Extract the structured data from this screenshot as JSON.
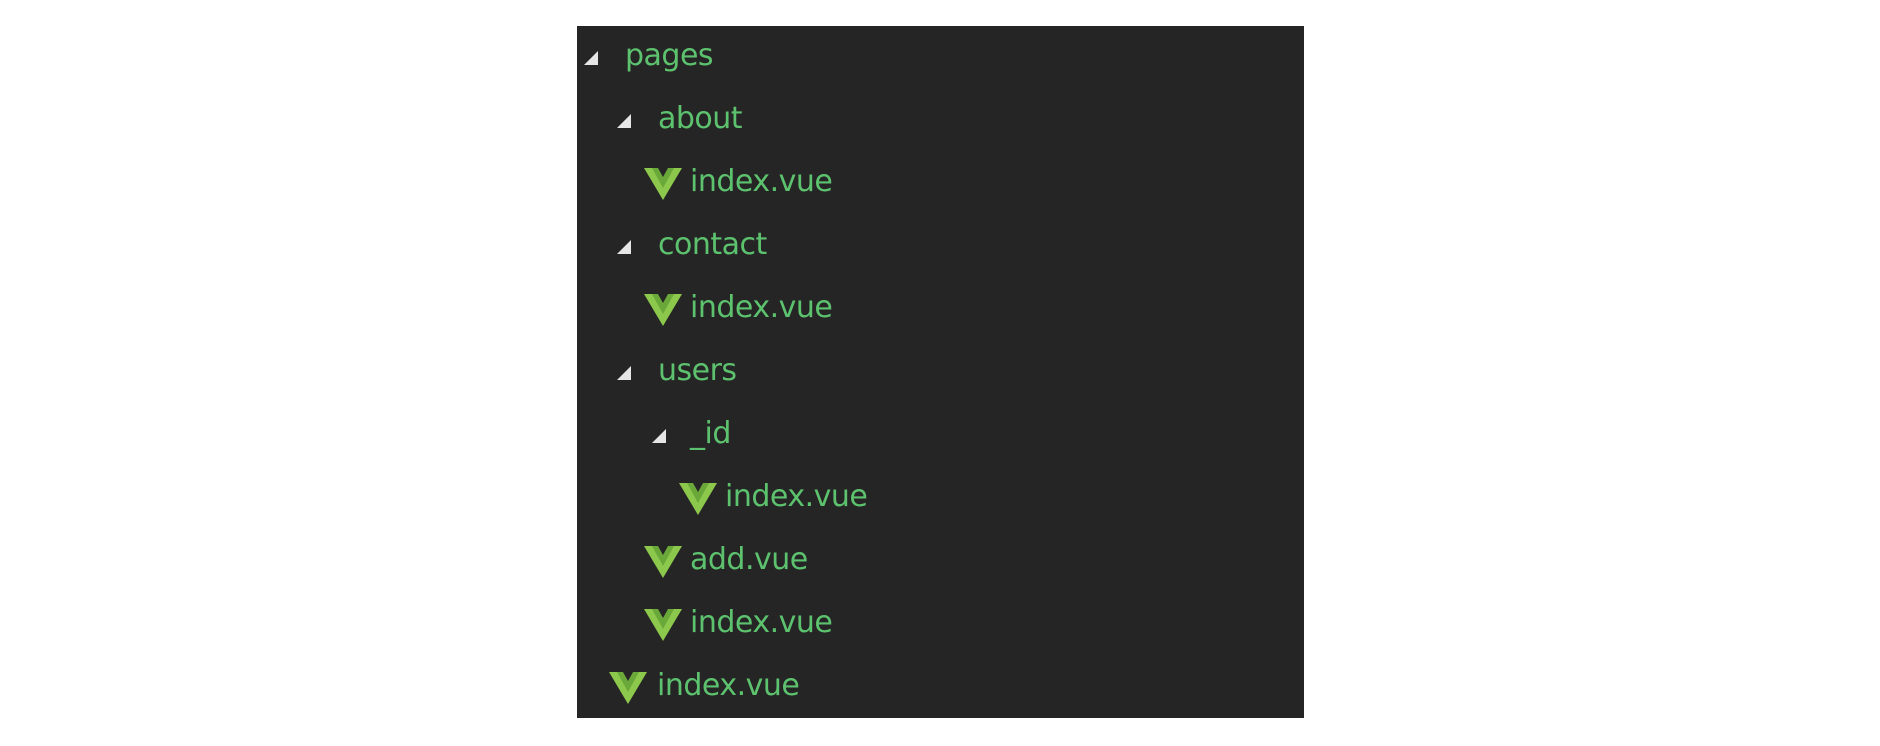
{
  "tree": {
    "items": [
      {
        "label": "pages",
        "type": "folder",
        "depth": 0,
        "expanded": true
      },
      {
        "label": "about",
        "type": "folder",
        "depth": 1,
        "expanded": true
      },
      {
        "label": "index.vue",
        "type": "vue-file",
        "depth": 2
      },
      {
        "label": "contact",
        "type": "folder",
        "depth": 1,
        "expanded": true
      },
      {
        "label": "index.vue",
        "type": "vue-file",
        "depth": 2
      },
      {
        "label": "users",
        "type": "folder",
        "depth": 1,
        "expanded": true
      },
      {
        "label": "_id",
        "type": "folder",
        "depth": 2,
        "expanded": true
      },
      {
        "label": "index.vue",
        "type": "vue-file",
        "depth": 3
      },
      {
        "label": "add.vue",
        "type": "vue-file",
        "depth": 2
      },
      {
        "label": "index.vue",
        "type": "vue-file",
        "depth": 2
      },
      {
        "label": "index.vue",
        "type": "vue-file",
        "depth": 1
      }
    ]
  },
  "colors": {
    "background": "#252526",
    "text": "#5dc26e",
    "vue_icon": "#8cc84b",
    "expand_triangle": "#e6e6e6"
  }
}
